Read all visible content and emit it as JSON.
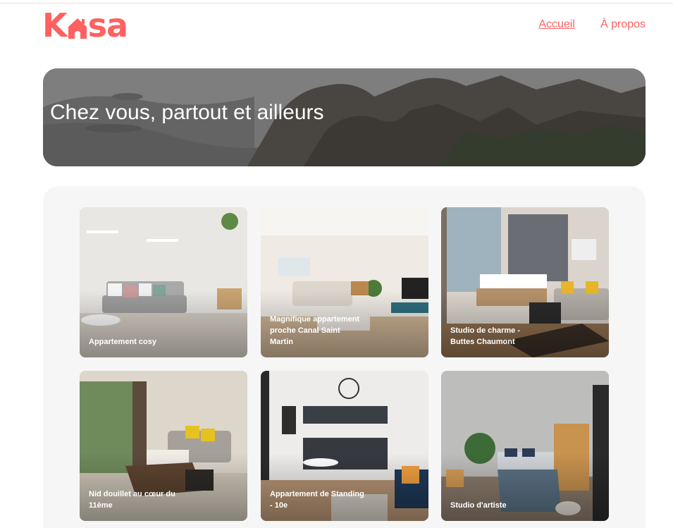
{
  "colors": {
    "brand": "#FF6060",
    "panel": "#F6F6F6"
  },
  "logo": {
    "left": "K",
    "right": "sa",
    "house_icon": "house-icon"
  },
  "nav": {
    "home": "Accueil",
    "about": "À propos"
  },
  "banner": {
    "title": "Chez vous, partout et ailleurs"
  },
  "cards": [
    {
      "title": "Appartement cosy"
    },
    {
      "title": "Magnifique appartement proche Canal Saint Martin"
    },
    {
      "title": "Studio de charme - Buttes Chaumont"
    },
    {
      "title": "Nid douillet au cœur du 11ème"
    },
    {
      "title": "Appartement de Standing - 10e"
    },
    {
      "title": "Studio d'artiste"
    }
  ]
}
